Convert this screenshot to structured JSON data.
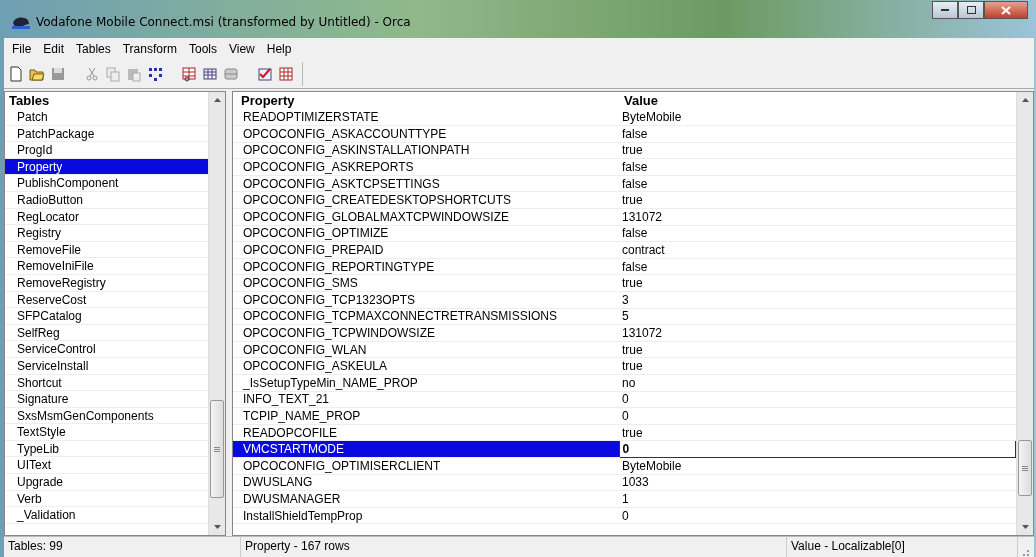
{
  "window": {
    "title": "Vodafone Mobile Connect.msi (transformed by Untitled) - Orca"
  },
  "menu": [
    "File",
    "Edit",
    "Tables",
    "Transform",
    "Tools",
    "View",
    "Help"
  ],
  "tables_pane": {
    "header": "Tables",
    "items": [
      {
        "label": "Patch",
        "selected": false
      },
      {
        "label": "PatchPackage",
        "selected": false
      },
      {
        "label": "ProgId",
        "selected": false
      },
      {
        "label": "Property",
        "selected": true
      },
      {
        "label": "PublishComponent",
        "selected": false
      },
      {
        "label": "RadioButton",
        "selected": false
      },
      {
        "label": "RegLocator",
        "selected": false
      },
      {
        "label": "Registry",
        "selected": false
      },
      {
        "label": "RemoveFile",
        "selected": false
      },
      {
        "label": "RemoveIniFile",
        "selected": false
      },
      {
        "label": "RemoveRegistry",
        "selected": false
      },
      {
        "label": "ReserveCost",
        "selected": false
      },
      {
        "label": "SFPCatalog",
        "selected": false
      },
      {
        "label": "SelfReg",
        "selected": false
      },
      {
        "label": "ServiceControl",
        "selected": false
      },
      {
        "label": "ServiceInstall",
        "selected": false
      },
      {
        "label": "Shortcut",
        "selected": false
      },
      {
        "label": "Signature",
        "selected": false
      },
      {
        "label": "SxsMsmGenComponents",
        "selected": false
      },
      {
        "label": "TextStyle",
        "selected": false
      },
      {
        "label": "TypeLib",
        "selected": false
      },
      {
        "label": "UIText",
        "selected": false
      },
      {
        "label": "Upgrade",
        "selected": false
      },
      {
        "label": "Verb",
        "selected": false
      },
      {
        "label": "_Validation",
        "selected": false
      }
    ]
  },
  "property_table": {
    "columns": [
      "Property",
      "Value"
    ],
    "rows": [
      {
        "property": "READOPTIMIZERSTATE",
        "value": "ByteMobile",
        "selected": false
      },
      {
        "property": "OPCOCONFIG_ASKACCOUNTTYPE",
        "value": "false",
        "selected": false
      },
      {
        "property": "OPCOCONFIG_ASKINSTALLATIONPATH",
        "value": "true",
        "selected": false
      },
      {
        "property": "OPCOCONFIG_ASKREPORTS",
        "value": "false",
        "selected": false
      },
      {
        "property": "OPCOCONFIG_ASKTCPSETTINGS",
        "value": "false",
        "selected": false
      },
      {
        "property": "OPCOCONFIG_CREATEDESKTOPSHORTCUTS",
        "value": "true",
        "selected": false
      },
      {
        "property": "OPCOCONFIG_GLOBALMAXTCPWINDOWSIZE",
        "value": "131072",
        "selected": false
      },
      {
        "property": "OPCOCONFIG_OPTIMIZE",
        "value": "false",
        "selected": false
      },
      {
        "property": "OPCOCONFIG_PREPAID",
        "value": "contract",
        "selected": false
      },
      {
        "property": "OPCOCONFIG_REPORTINGTYPE",
        "value": "false",
        "selected": false
      },
      {
        "property": "OPCOCONFIG_SMS",
        "value": "true",
        "selected": false
      },
      {
        "property": "OPCOCONFIG_TCP1323OPTS",
        "value": "3",
        "selected": false
      },
      {
        "property": "OPCOCONFIG_TCPMAXCONNECTRETRANSMISSIONS",
        "value": "5",
        "selected": false
      },
      {
        "property": "OPCOCONFIG_TCPWINDOWSIZE",
        "value": "131072",
        "selected": false
      },
      {
        "property": "OPCOCONFIG_WLAN",
        "value": "true",
        "selected": false
      },
      {
        "property": "OPCOCONFIG_ASKEULA",
        "value": "true",
        "selected": false
      },
      {
        "property": "_IsSetupTypeMin_NAME_PROP",
        "value": "no",
        "selected": false
      },
      {
        "property": "INFO_TEXT_21",
        "value": "0",
        "selected": false
      },
      {
        "property": "TCPIP_NAME_PROP",
        "value": "0",
        "selected": false
      },
      {
        "property": "READOPCOFILE",
        "value": "true",
        "selected": false
      },
      {
        "property": "VMCSTARTMODE",
        "value": "0",
        "selected": true
      },
      {
        "property": "OPCOCONFIG_OPTIMISERCLIENT",
        "value": "ByteMobile",
        "selected": false
      },
      {
        "property": "DWUSLANG",
        "value": "1033",
        "selected": false
      },
      {
        "property": "DWUSMANAGER",
        "value": "1",
        "selected": false
      },
      {
        "property": "InstallShieldTempProp",
        "value": "0",
        "selected": false
      }
    ]
  },
  "status_bar": {
    "tables_count": "Tables: 99",
    "table_info": "Property - 167 rows",
    "column_info": "Value - Localizable[0]"
  }
}
